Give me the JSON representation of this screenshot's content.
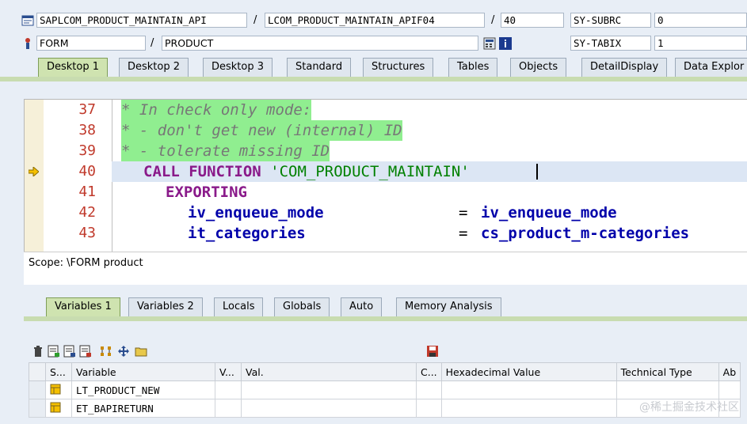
{
  "header": {
    "row1": {
      "program": "SAPLCOM_PRODUCT_MAINTAIN_API",
      "include": "LCOM_PRODUCT_MAINTAIN_APIF04",
      "line": "40",
      "sys_field": "SY-SUBRC",
      "sys_value": "0"
    },
    "row2": {
      "event_type": "FORM",
      "event_name": "PRODUCT",
      "sys_field": "SY-TABIX",
      "sys_value": "1"
    }
  },
  "main_tabs": [
    "Desktop 1",
    "Desktop 2",
    "Desktop 3",
    "Standard",
    "Structures",
    "Tables",
    "Objects",
    "DetailDisplay",
    "Data Explor"
  ],
  "editor": {
    "lines": [
      {
        "no": "37",
        "text": "* In check only mode:"
      },
      {
        "no": "38",
        "text": "* - don't get new (internal) ID"
      },
      {
        "no": "39",
        "text": "* - tolerate missing ID"
      },
      {
        "no": "40",
        "kw": "CALL FUNCTION ",
        "str": "'COM_PRODUCT_MAINTAIN'"
      },
      {
        "no": "41",
        "kw": "EXPORTING"
      },
      {
        "no": "42",
        "param": "iv_enqueue_mode",
        "eq": "= ",
        "val": "iv_enqueue_mode"
      },
      {
        "no": "43",
        "param": "it_categories",
        "eq": "= ",
        "val": "cs_product_m-categories"
      }
    ]
  },
  "scope": "Scope: \\FORM product",
  "var_tabs": [
    "Variables 1",
    "Variables 2",
    "Locals",
    "Globals",
    "Auto",
    "Memory Analysis"
  ],
  "grid": {
    "headers": [
      "S...",
      "Variable",
      "V...",
      "Val.",
      "C...",
      "Hexadecimal Value",
      "Technical Type",
      "Ab"
    ],
    "rows": [
      {
        "variable": "LT_PRODUCT_NEW"
      },
      {
        "variable": "ET_BAPIRETURN"
      }
    ]
  },
  "watermark": "@稀土掘金技术社区"
}
